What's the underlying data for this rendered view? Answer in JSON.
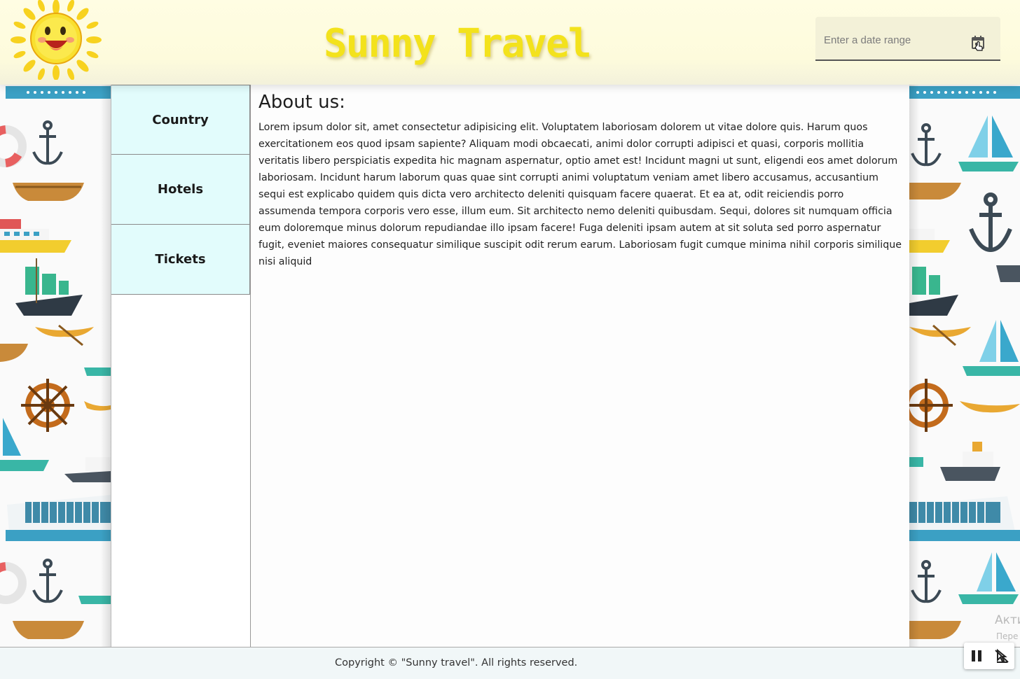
{
  "header": {
    "brand": "Sunny Travel",
    "date_placeholder": "Enter a date range",
    "calendar_icon": "calendar-icon"
  },
  "nav": {
    "items": [
      {
        "label": "Country"
      },
      {
        "label": "Hotels"
      },
      {
        "label": "Tickets"
      }
    ]
  },
  "main": {
    "title": "About us:",
    "body": "Lorem ipsum dolor sit, amet consectetur adipisicing elit. Voluptatem laboriosam dolorem ut vitae dolore quis. Harum quos exercitationem eos quod ipsam sapiente? Aliquam modi obcaecati, animi dolor corrupti adipisci et quasi, corporis mollitia veritatis libero perspiciatis expedita hic magnam aspernatur, optio amet est! Incidunt magni ut sunt, eligendi eos amet dolorum laboriosam. Incidunt harum laborum quas quae sint corrupti animi voluptatum veniam amet libero accusamus, accusantium sequi est explicabo quidem quis dicta vero architecto deleniti quisquam facere quaerat. Et ea at, odit reiciendis porro assumenda tempora corporis vero esse, illum eum. Sit architecto nemo deleniti quibusdam. Sequi, dolores sit numquam officia eum doloremque minus dolorum repudiandae illo ipsam facere! Fuga deleniti ipsam autem at sit soluta sed porro aspernatur fugit, eveniet maiores consequatur similique suscipit odit rerum earum. Laboriosam fugit cumque minima nihil corporis similique nisi aliquid"
  },
  "footer": {
    "copyright": "Copyright © \"Sunny travel\". All rights reserved."
  },
  "overlay": {
    "activate_line1": "Акти",
    "activate_line2": "Пере"
  },
  "colors": {
    "brand": "#f3e21c",
    "nav_bg": "#e2fcfc",
    "header_bg": "#fffde3"
  }
}
